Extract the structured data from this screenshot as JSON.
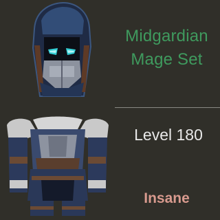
{
  "item": {
    "name": "Midgardian\nMage Set",
    "level": "Level 180",
    "difficulty": "Insane"
  },
  "icons": [
    "helmet-icon",
    "chestplate-icon"
  ],
  "colors": {
    "background": "#302f29",
    "name": "#3f9a5e",
    "level": "#e8e8e8",
    "difficulty": "#d89a8e",
    "divider": "#8a8a84"
  }
}
